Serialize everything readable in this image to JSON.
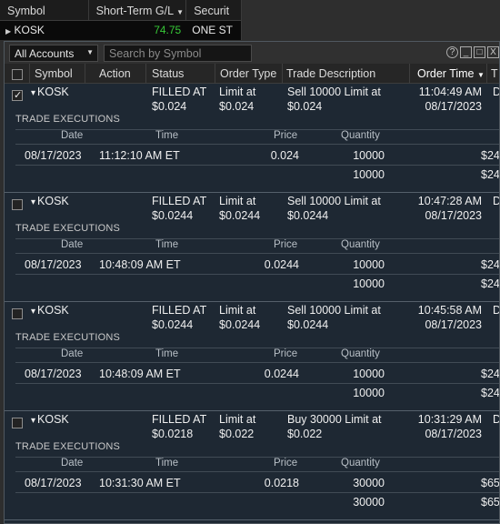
{
  "bg_widget": {
    "columns": [
      "Symbol",
      "Short-Term G/L",
      "Securit"
    ],
    "row": {
      "symbol": "KOSK",
      "gl": "74.75",
      "security": "ONE ST"
    }
  },
  "toolbar": {
    "account_select": "All Accounts",
    "search_placeholder": "Search by Symbol"
  },
  "window_buttons": [
    "?",
    "_",
    "□",
    "X"
  ],
  "columns": {
    "symbol": "Symbol",
    "action": "Action",
    "status": "Status",
    "order_type": "Order Type",
    "trade_description": "Trade Description",
    "order_time": "Order Time",
    "extra": "T"
  },
  "section_label": "TRADE EXECUTIONS",
  "exec_columns": {
    "date": "Date",
    "time": "Time",
    "price": "Price",
    "quantity": "Quantity"
  },
  "orders": [
    {
      "checked": true,
      "symbol": "KOSK",
      "status_1": "FILLED AT",
      "status_2": "$0.024",
      "type_1": "Limit at",
      "type_2": "$0.024",
      "desc_1": "Sell 10000 Limit at",
      "desc_2": "$0.024",
      "time_1": "11:04:49 AM",
      "time_2": "08/17/2023",
      "trail_1": "D",
      "exec_date": "08/17/2023",
      "exec_time": "11:12:10 AM ET",
      "exec_price": "0.024",
      "exec_qty": "10000",
      "exec_total": "$24",
      "sum_qty": "10000",
      "sum_total": "$24"
    },
    {
      "checked": false,
      "symbol": "KOSK",
      "status_1": "FILLED AT",
      "status_2": "$0.0244",
      "type_1": "Limit at",
      "type_2": "$0.0244",
      "desc_1": "Sell 10000 Limit at",
      "desc_2": "$0.0244",
      "time_1": "10:47:28 AM",
      "time_2": "08/17/2023",
      "trail_1": "D",
      "exec_date": "08/17/2023",
      "exec_time": "10:48:09 AM ET",
      "exec_price": "0.0244",
      "exec_qty": "10000",
      "exec_total": "$24",
      "sum_qty": "10000",
      "sum_total": "$24"
    },
    {
      "checked": false,
      "symbol": "KOSK",
      "status_1": "FILLED AT",
      "status_2": "$0.0244",
      "type_1": "Limit at",
      "type_2": "$0.0244",
      "desc_1": "Sell 10000 Limit at",
      "desc_2": "$0.0244",
      "time_1": "10:45:58 AM",
      "time_2": "08/17/2023",
      "trail_1": "D",
      "exec_date": "08/17/2023",
      "exec_time": "10:48:09 AM ET",
      "exec_price": "0.0244",
      "exec_qty": "10000",
      "exec_total": "$24",
      "sum_qty": "10000",
      "sum_total": "$24"
    },
    {
      "checked": false,
      "symbol": "KOSK",
      "status_1": "FILLED AT",
      "status_2": "$0.0218",
      "type_1": "Limit at",
      "type_2": "$0.022",
      "desc_1": "Buy 30000 Limit at",
      "desc_2": "$0.022",
      "time_1": "10:31:29 AM",
      "time_2": "08/17/2023",
      "trail_1": "D",
      "exec_date": "08/17/2023",
      "exec_time": "10:31:30 AM ET",
      "exec_price": "0.0218",
      "exec_qty": "30000",
      "exec_total": "$65",
      "sum_qty": "30000",
      "sum_total": "$65"
    }
  ]
}
